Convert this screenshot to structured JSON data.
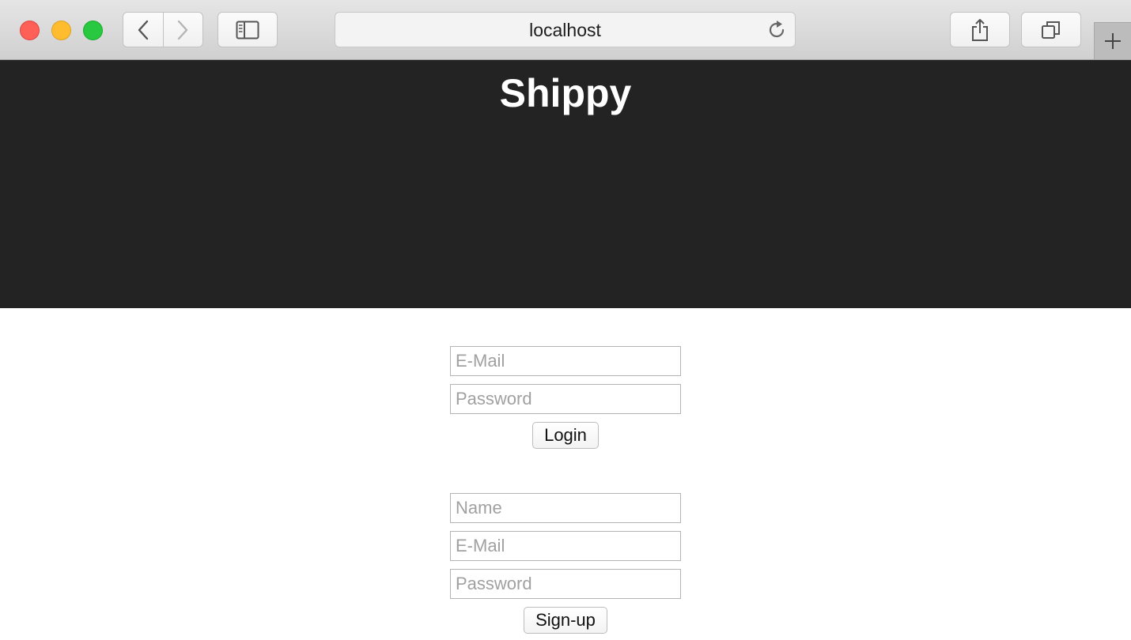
{
  "browser": {
    "url": "localhost",
    "icons": {
      "close": "close-icon",
      "minimize": "minimize-icon",
      "maximize": "maximize-icon",
      "back": "chevron-left-icon",
      "forward": "chevron-right-icon",
      "sidebar": "sidebar-icon",
      "reload": "reload-icon",
      "share": "share-icon",
      "tabs": "tabs-icon",
      "new_tab": "plus-icon"
    },
    "colors": {
      "close": "#fe5f57",
      "minimize": "#febc2e",
      "maximize": "#28c840"
    }
  },
  "page": {
    "title": "Shippy",
    "hero_color": "#232323"
  },
  "login": {
    "email_placeholder": "E-Mail",
    "password_placeholder": "Password",
    "submit_label": "Login"
  },
  "signup": {
    "name_placeholder": "Name",
    "email_placeholder": "E-Mail",
    "password_placeholder": "Password",
    "submit_label": "Sign-up"
  }
}
